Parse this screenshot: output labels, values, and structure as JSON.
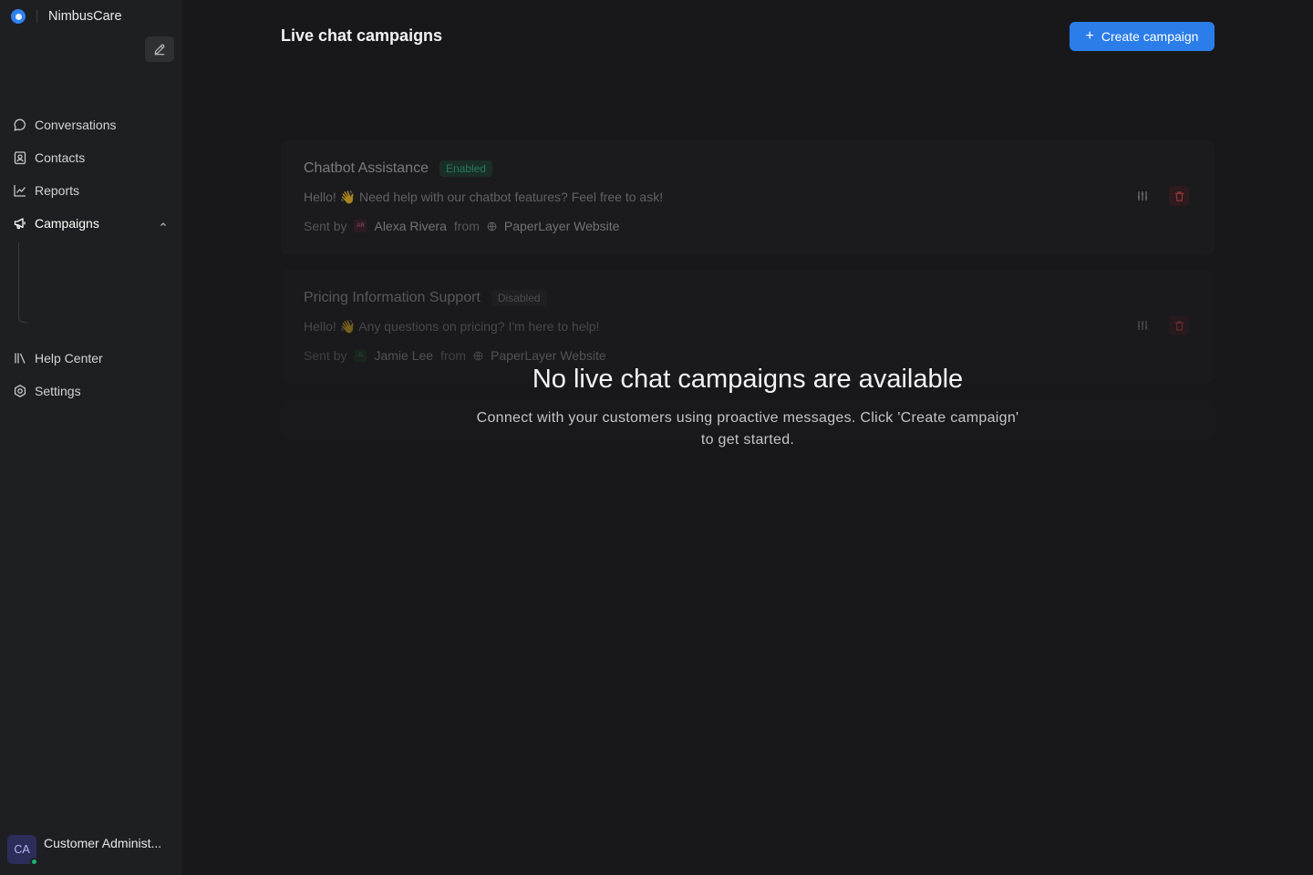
{
  "brand": {
    "name": "NimbusCare"
  },
  "sidebar": {
    "items": [
      {
        "label": "Conversations"
      },
      {
        "label": "Contacts"
      },
      {
        "label": "Reports"
      },
      {
        "label": "Campaigns"
      },
      {
        "label": "Help Center"
      },
      {
        "label": "Settings"
      }
    ],
    "profile": {
      "initials": "CA",
      "name": "Customer Administ..."
    }
  },
  "main": {
    "title": "Live chat campaigns",
    "create_label": "Create campaign",
    "campaigns": [
      {
        "title": "Chatbot Assistance",
        "status": "Enabled",
        "message": "Hello! 👋 Need help with our chatbot features? Feel free to ask!",
        "sent_by_label": "Sent by",
        "sender": "Alexa Rivera",
        "sender_initials": "AR",
        "from_label": "from",
        "inbox": "PaperLayer Website"
      },
      {
        "title": "Pricing Information Support",
        "status": "Disabled",
        "message": "Hello! 👋 Any questions on pricing? I'm here to help!",
        "sent_by_label": "Sent by",
        "sender": "Jamie Lee",
        "sender_initials": "JL",
        "from_label": "from",
        "inbox": "PaperLayer Website"
      }
    ],
    "empty_state": {
      "title": "No live chat campaigns are available",
      "description": "Connect with your customers using proactive messages. Click 'Create campaign' to get started."
    }
  },
  "colors": {
    "accent": "#2b7de9",
    "enabled": "#2ab987",
    "danger": "#e5484d"
  }
}
